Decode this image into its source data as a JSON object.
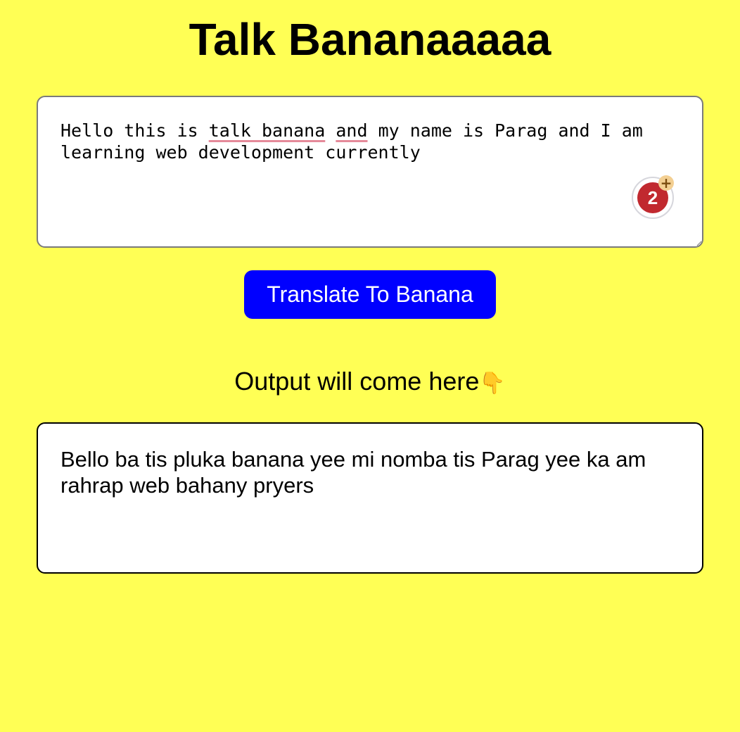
{
  "header": {
    "title": "Talk Bananaaaaa"
  },
  "input": {
    "value_parts": {
      "part1": "Hello this is ",
      "part2": "talk banana",
      "part3": " ",
      "part4": "and",
      "part5": " my name is Parag and I am learning web development currently"
    },
    "underline_color": "#e58a9a"
  },
  "grammar_badge": {
    "count": "2",
    "plus_icon": "+",
    "icon": "grammar-checker-icon",
    "color": "#c1292f"
  },
  "translate_button": {
    "label": "Translate To Banana",
    "color": "#0000ff"
  },
  "output": {
    "label": "Output will come here",
    "pointer_icon": "👇",
    "text": "Bello ba tis pluka banana yee mi nomba tis Parag yee ka am rahrap web bahany pryers"
  },
  "theme": {
    "background": "#ffff55"
  }
}
